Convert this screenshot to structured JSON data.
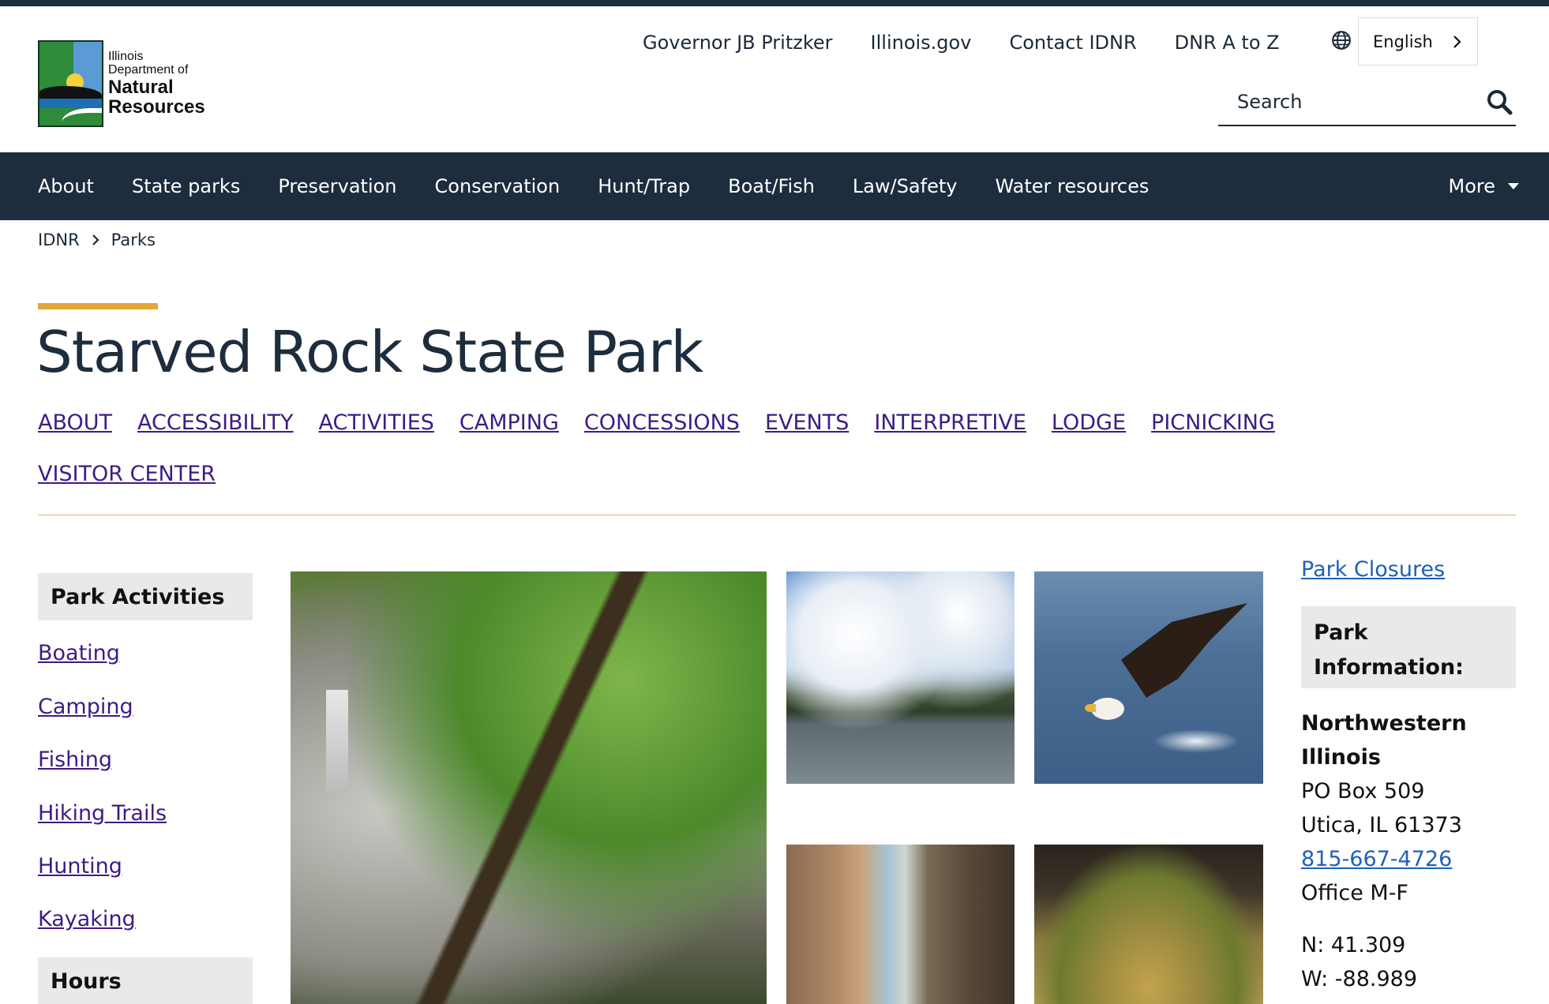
{
  "header": {
    "logo": {
      "line1": "Illinois",
      "line2": "Department of",
      "line3": "Natural",
      "line4": "Resources"
    },
    "utility_links": [
      "Governor JB Pritzker",
      "Illinois.gov",
      "Contact IDNR",
      "DNR A to Z"
    ],
    "language": "English",
    "search_placeholder": "Search"
  },
  "main_nav": {
    "items": [
      "About",
      "State parks",
      "Preservation",
      "Conservation",
      "Hunt/Trap",
      "Boat/Fish",
      "Law/Safety",
      "Water resources"
    ],
    "more_label": "More"
  },
  "breadcrumb": [
    "IDNR",
    "Parks"
  ],
  "page": {
    "title": "Starved Rock State Park",
    "section_links": [
      "ABOUT",
      "ACCESSIBILITY",
      "ACTIVITIES",
      "CAMPING",
      "CONCESSIONS",
      "EVENTS",
      "INTERPRETIVE",
      "LODGE",
      "PICNICKING",
      "VISITOR CENTER"
    ]
  },
  "sidebar": {
    "activities_heading": "Park Activities",
    "activities": [
      "Boating",
      "Camping",
      "Fishing",
      "Hiking Trails",
      "Hunting",
      "Kayaking"
    ],
    "hours_heading": "Hours"
  },
  "info": {
    "closures_link": "Park Closures",
    "heading": "Park Information:",
    "region": "Northwestern Illinois",
    "address1": "PO Box 509",
    "address2": "Utica, IL 61373",
    "phone": "815-667-4726",
    "office": "Office M-F",
    "lat": "N: 41.309",
    "lon": "W: -88.989"
  },
  "colors": {
    "nav_bg": "#1d2d3d",
    "accent": "#e2a83a",
    "visited_link": "#3f1b86",
    "link": "#1f61b8"
  }
}
